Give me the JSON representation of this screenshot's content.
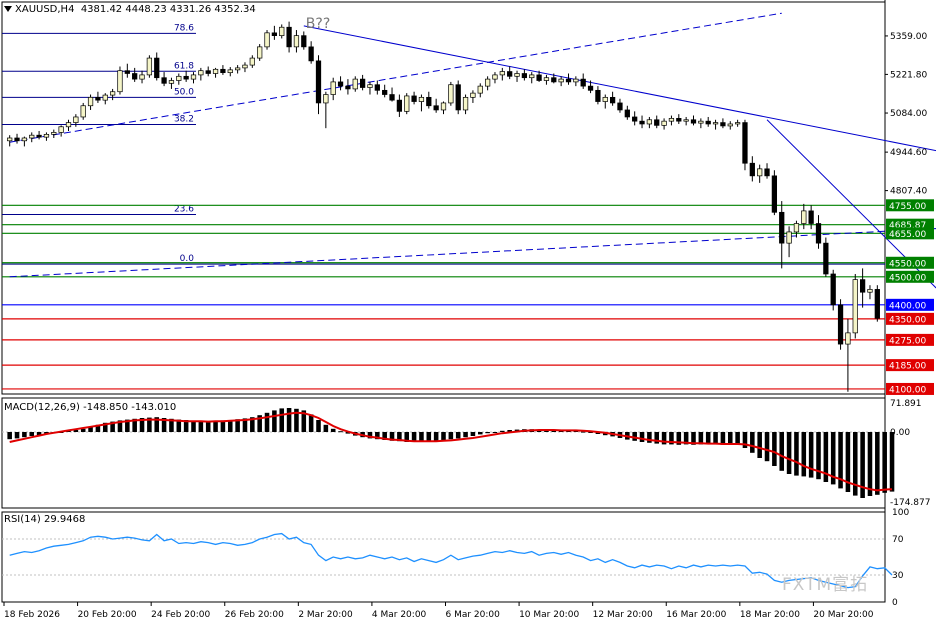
{
  "header": {
    "symbol": "XAUUSD,H4",
    "ohlc": "4381.42 4448.23 4331.26 4352.34"
  },
  "wave_label": "B??",
  "watermark": "FXTM富拓",
  "colors": {
    "bull": "#f5f5c8",
    "bear": "#000000",
    "fib": "#00008b",
    "support": "#008000",
    "resistance": "#e00000",
    "trend": "#0000cd",
    "macd_signal": "#e00000",
    "rsi": "#1e90ff",
    "current_level_bg": "#0000ff",
    "green_tag_bg": "#008000",
    "red_tag_bg": "#e00000"
  },
  "chart_data": [
    {
      "type": "candlestick",
      "title": "XAUUSD,H4",
      "ylim": [
        4082,
        5480
      ],
      "y_ticks": [
        "5359.00",
        "5221.80",
        "5084.00",
        "4944.60",
        "4807.40"
      ],
      "x_ticks": [
        "18 Feb 2026",
        "20 Feb 20:00",
        "24 Feb 20:00",
        "26 Feb 20:00",
        "2 Mar 20:00",
        "4 Mar 20:00",
        "6 Mar 20:00",
        "10 Mar 20:00",
        "12 Mar 20:00",
        "16 Mar 20:00",
        "18 Mar 20:00",
        "20 Mar 20:00"
      ],
      "fib_levels": [
        {
          "label": "78.6",
          "value": 5368
        },
        {
          "label": "61.8",
          "value": 5233
        },
        {
          "label": "50.0",
          "value": 5140
        },
        {
          "label": "38.2",
          "value": 5043
        },
        {
          "label": "23.6",
          "value": 4722
        },
        {
          "label": "0.0",
          "value": 4545
        }
      ],
      "horizontal_levels": [
        {
          "value": 4755,
          "label": "4755.00",
          "kind": "support"
        },
        {
          "value": 4685.87,
          "label": "4685.87",
          "kind": "support"
        },
        {
          "value": 4655,
          "label": "4655.00",
          "kind": "support"
        },
        {
          "value": 4550,
          "label": "4550.00",
          "kind": "support"
        },
        {
          "value": 4500,
          "label": "4500.00",
          "kind": "support"
        },
        {
          "value": 4400,
          "label": "4400.00",
          "kind": "current"
        },
        {
          "value": 4350,
          "label": "4350.00",
          "kind": "resistance"
        },
        {
          "value": 4275,
          "label": "4275.00",
          "kind": "resistance"
        },
        {
          "value": 4185,
          "label": "4185.00",
          "kind": "resistance"
        },
        {
          "value": 4100,
          "label": "4100.00",
          "kind": "resistance"
        }
      ],
      "candles": [
        [
          4985,
          5005,
          4965,
          4995
        ],
        [
          4995,
          5010,
          4975,
          4985
        ],
        [
          4985,
          5000,
          4965,
          4995
        ],
        [
          4995,
          5015,
          4980,
          5005
        ],
        [
          5005,
          5020,
          4990,
          4998
        ],
        [
          4998,
          5015,
          4985,
          5008
        ],
        [
          5008,
          5025,
          4995,
          5015
        ],
        [
          5015,
          5040,
          5000,
          5035
        ],
        [
          5035,
          5060,
          5020,
          5050
        ],
        [
          5050,
          5080,
          5035,
          5070
        ],
        [
          5070,
          5120,
          5060,
          5110
        ],
        [
          5110,
          5150,
          5095,
          5140
        ],
        [
          5140,
          5160,
          5120,
          5130
        ],
        [
          5130,
          5155,
          5115,
          5148
        ],
        [
          5148,
          5170,
          5130,
          5160
        ],
        [
          5160,
          5250,
          5150,
          5235
        ],
        [
          5235,
          5260,
          5210,
          5225
        ],
        [
          5225,
          5245,
          5195,
          5205
        ],
        [
          5205,
          5235,
          5190,
          5220
        ],
        [
          5220,
          5290,
          5210,
          5280
        ],
        [
          5280,
          5300,
          5200,
          5210
        ],
        [
          5210,
          5230,
          5180,
          5190
        ],
        [
          5190,
          5210,
          5170,
          5200
        ],
        [
          5200,
          5225,
          5185,
          5215
        ],
        [
          5215,
          5235,
          5195,
          5205
        ],
        [
          5205,
          5230,
          5190,
          5220
        ],
        [
          5220,
          5245,
          5200,
          5235
        ],
        [
          5235,
          5250,
          5215,
          5225
        ],
        [
          5225,
          5245,
          5210,
          5240
        ],
        [
          5240,
          5255,
          5220,
          5228
        ],
        [
          5228,
          5248,
          5215,
          5238
        ],
        [
          5238,
          5255,
          5225,
          5245
        ],
        [
          5245,
          5265,
          5230,
          5255
        ],
        [
          5255,
          5290,
          5245,
          5280
        ],
        [
          5280,
          5330,
          5270,
          5320
        ],
        [
          5320,
          5380,
          5310,
          5370
        ],
        [
          5370,
          5395,
          5345,
          5360
        ],
        [
          5360,
          5400,
          5350,
          5390
        ],
        [
          5390,
          5410,
          5300,
          5320
        ],
        [
          5320,
          5380,
          5300,
          5360
        ],
        [
          5360,
          5375,
          5310,
          5320
        ],
        [
          5320,
          5340,
          5260,
          5270
        ],
        [
          5270,
          5290,
          5080,
          5120
        ],
        [
          5120,
          5160,
          5030,
          5150
        ],
        [
          5150,
          5210,
          5130,
          5195
        ],
        [
          5195,
          5215,
          5165,
          5180
        ],
        [
          5180,
          5205,
          5150,
          5170
        ],
        [
          5170,
          5215,
          5160,
          5205
        ],
        [
          5205,
          5220,
          5165,
          5175
        ],
        [
          5175,
          5195,
          5150,
          5185
        ],
        [
          5185,
          5200,
          5150,
          5165
        ],
        [
          5165,
          5185,
          5140,
          5150
        ],
        [
          5150,
          5175,
          5125,
          5130
        ],
        [
          5130,
          5150,
          5070,
          5090
        ],
        [
          5090,
          5155,
          5080,
          5145
        ],
        [
          5145,
          5160,
          5115,
          5125
        ],
        [
          5125,
          5150,
          5090,
          5140
        ],
        [
          5140,
          5160,
          5100,
          5110
        ],
        [
          5110,
          5135,
          5085,
          5095
        ],
        [
          5095,
          5125,
          5080,
          5120
        ],
        [
          5120,
          5195,
          5110,
          5185
        ],
        [
          5185,
          5200,
          5080,
          5095
        ],
        [
          5095,
          5150,
          5080,
          5140
        ],
        [
          5140,
          5165,
          5120,
          5155
        ],
        [
          5155,
          5190,
          5140,
          5180
        ],
        [
          5180,
          5215,
          5165,
          5205
        ],
        [
          5205,
          5230,
          5190,
          5220
        ],
        [
          5220,
          5245,
          5200,
          5232
        ],
        [
          5232,
          5250,
          5205,
          5215
        ],
        [
          5215,
          5235,
          5195,
          5225
        ],
        [
          5225,
          5240,
          5200,
          5210
        ],
        [
          5210,
          5230,
          5190,
          5220
        ],
        [
          5220,
          5235,
          5195,
          5200
        ],
        [
          5200,
          5220,
          5185,
          5210
        ],
        [
          5210,
          5225,
          5190,
          5195
        ],
        [
          5195,
          5215,
          5180,
          5205
        ],
        [
          5205,
          5225,
          5185,
          5195
        ],
        [
          5195,
          5215,
          5180,
          5205
        ],
        [
          5205,
          5225,
          5170,
          5180
        ],
        [
          5180,
          5200,
          5155,
          5165
        ],
        [
          5165,
          5180,
          5115,
          5125
        ],
        [
          5125,
          5150,
          5100,
          5140
        ],
        [
          5140,
          5160,
          5110,
          5120
        ],
        [
          5120,
          5135,
          5085,
          5095
        ],
        [
          5095,
          5110,
          5060,
          5070
        ],
        [
          5070,
          5090,
          5040,
          5055
        ],
        [
          5055,
          5075,
          5030,
          5045
        ],
        [
          5045,
          5070,
          5030,
          5060
        ],
        [
          5060,
          5075,
          5030,
          5040
        ],
        [
          5040,
          5065,
          5025,
          5055
        ],
        [
          5055,
          5075,
          5040,
          5065
        ],
        [
          5065,
          5080,
          5045,
          5055
        ],
        [
          5055,
          5070,
          5040,
          5060
        ],
        [
          5060,
          5075,
          5040,
          5048
        ],
        [
          5048,
          5065,
          5030,
          5055
        ],
        [
          5055,
          5070,
          5035,
          5045
        ],
        [
          5045,
          5060,
          5025,
          5050
        ],
        [
          5050,
          5065,
          5030,
          5038
        ],
        [
          5038,
          5055,
          5025,
          5045
        ],
        [
          5045,
          5060,
          5035,
          5050
        ],
        [
          5050,
          5060,
          4880,
          4905
        ],
        [
          4905,
          4930,
          4840,
          4860
        ],
        [
          4860,
          4900,
          4835,
          4885
        ],
        [
          4885,
          4905,
          4850,
          4860
        ],
        [
          4860,
          4880,
          4720,
          4730
        ],
        [
          4730,
          4770,
          4530,
          4620
        ],
        [
          4620,
          4680,
          4570,
          4660
        ],
        [
          4660,
          4700,
          4640,
          4690
        ],
        [
          4690,
          4760,
          4670,
          4735
        ],
        [
          4735,
          4755,
          4670,
          4690
        ],
        [
          4690,
          4720,
          4600,
          4620
        ],
        [
          4620,
          4640,
          4500,
          4510
        ],
        [
          4510,
          4525,
          4380,
          4400
        ],
        [
          4400,
          4420,
          4240,
          4260
        ],
        [
          4260,
          4350,
          4090,
          4300
        ],
        [
          4300,
          4510,
          4280,
          4490
        ],
        [
          4490,
          4530,
          4390,
          4445
        ],
        [
          4445,
          4470,
          4420,
          4455
        ],
        [
          4455,
          4470,
          4340,
          4352
        ]
      ],
      "trendlines": [
        {
          "name": "upper-channel-dashed",
          "points": [
            [
              0,
              4980
            ],
            [
              105,
              5440
            ]
          ],
          "style": "dashed"
        },
        {
          "name": "lower-channel-dashed",
          "points": [
            [
              0,
              4500
            ],
            [
              126,
              4672
            ]
          ],
          "style": "dashed"
        },
        {
          "name": "down-trend-main",
          "points": [
            [
              40,
              5395
            ],
            [
              126,
              4950
            ]
          ],
          "style": "solid"
        },
        {
          "name": "down-trend-short",
          "points": [
            [
              103,
              5060
            ],
            [
              126,
              4460
            ]
          ],
          "style": "solid"
        }
      ]
    },
    {
      "type": "histogram-with-signal",
      "title": "MACD(12,26,9) -148.850 -143.010",
      "ylim": [
        -190,
        85
      ],
      "y_ticks": [
        "71.891",
        "0.00",
        "-174.877"
      ],
      "macd": [
        -18,
        -16,
        -13,
        -10,
        -8,
        -5,
        -2,
        0,
        3,
        5,
        8,
        12,
        18,
        23,
        26,
        29,
        31,
        33,
        35,
        36,
        37,
        35,
        33,
        31,
        30,
        28,
        27,
        27,
        28,
        29,
        30,
        32,
        34,
        37,
        42,
        48,
        54,
        59,
        60,
        58,
        54,
        44,
        30,
        18,
        8,
        2,
        -4,
        -9,
        -13,
        -16,
        -18,
        -20,
        -22,
        -23,
        -25,
        -25,
        -25,
        -24,
        -23,
        -21,
        -18,
        -16,
        -13,
        -10,
        -6,
        -3,
        0,
        3,
        5,
        6,
        7,
        7,
        6,
        5,
        4,
        4,
        4,
        3,
        1,
        -2,
        -5,
        -8,
        -11,
        -15,
        -19,
        -22,
        -25,
        -27,
        -29,
        -31,
        -31,
        -32,
        -31,
        -32,
        -31,
        -31,
        -31,
        -32,
        -31,
        -32,
        -40,
        -52,
        -65,
        -73,
        -85,
        -97,
        -105,
        -109,
        -111,
        -114,
        -118,
        -125,
        -131,
        -141,
        -150,
        -159,
        -165,
        -160,
        -157,
        -152,
        -149
      ],
      "signal": [
        -25,
        -21,
        -17,
        -13,
        -9,
        -5,
        -2,
        1,
        4,
        7,
        10,
        13,
        16,
        19,
        22,
        25,
        27,
        29,
        30,
        31,
        31,
        30,
        29,
        28,
        27,
        27,
        27,
        26,
        27,
        27,
        28,
        29,
        30,
        32,
        34,
        37,
        40,
        43,
        46,
        48,
        47,
        42,
        35,
        25,
        15,
        7,
        1,
        -4,
        -8,
        -12,
        -14,
        -17,
        -19,
        -20,
        -22,
        -23,
        -23,
        -23,
        -23,
        -22,
        -21,
        -19,
        -17,
        -15,
        -12,
        -9,
        -6,
        -3,
        -1,
        1,
        3,
        4,
        5,
        5,
        5,
        4,
        4,
        4,
        3,
        2,
        0,
        -2,
        -5,
        -8,
        -11,
        -14,
        -17,
        -20,
        -22,
        -24,
        -25,
        -26,
        -27,
        -28,
        -28,
        -29,
        -29,
        -30,
        -30,
        -30,
        -31,
        -35,
        -40,
        -45,
        -50,
        -60,
        -68,
        -75,
        -85,
        -92,
        -98,
        -104,
        -112,
        -118,
        -126,
        -132,
        -138,
        -143,
        -146,
        -144,
        -143
      ]
    },
    {
      "type": "line",
      "title": "RSI(14) 29.9468",
      "ylim": [
        0,
        100
      ],
      "y_ticks": [
        "100",
        "70",
        "30",
        "0"
      ],
      "values": [
        52,
        54,
        56,
        55,
        57,
        60,
        62,
        63,
        64,
        66,
        68,
        72,
        73,
        72,
        70,
        71,
        72,
        71,
        69,
        68,
        75,
        68,
        70,
        65,
        66,
        65,
        67,
        66,
        64,
        66,
        65,
        63,
        64,
        66,
        70,
        72,
        75,
        76,
        70,
        72,
        66,
        64,
        52,
        46,
        50,
        48,
        50,
        48,
        49,
        52,
        50,
        48,
        50,
        47,
        49,
        45,
        48,
        46,
        44,
        47,
        52,
        47,
        49,
        51,
        52,
        54,
        56,
        55,
        57,
        55,
        54,
        56,
        52,
        54,
        55,
        53,
        55,
        52,
        50,
        46,
        48,
        44,
        47,
        44,
        40,
        38,
        41,
        39,
        41,
        40,
        37,
        40,
        38,
        41,
        39,
        41,
        40,
        41,
        40,
        41,
        40,
        32,
        33,
        31,
        24,
        22,
        24,
        25,
        26,
        27,
        24,
        22,
        20,
        18,
        16,
        17,
        29,
        39,
        37,
        38,
        30
      ]
    }
  ]
}
